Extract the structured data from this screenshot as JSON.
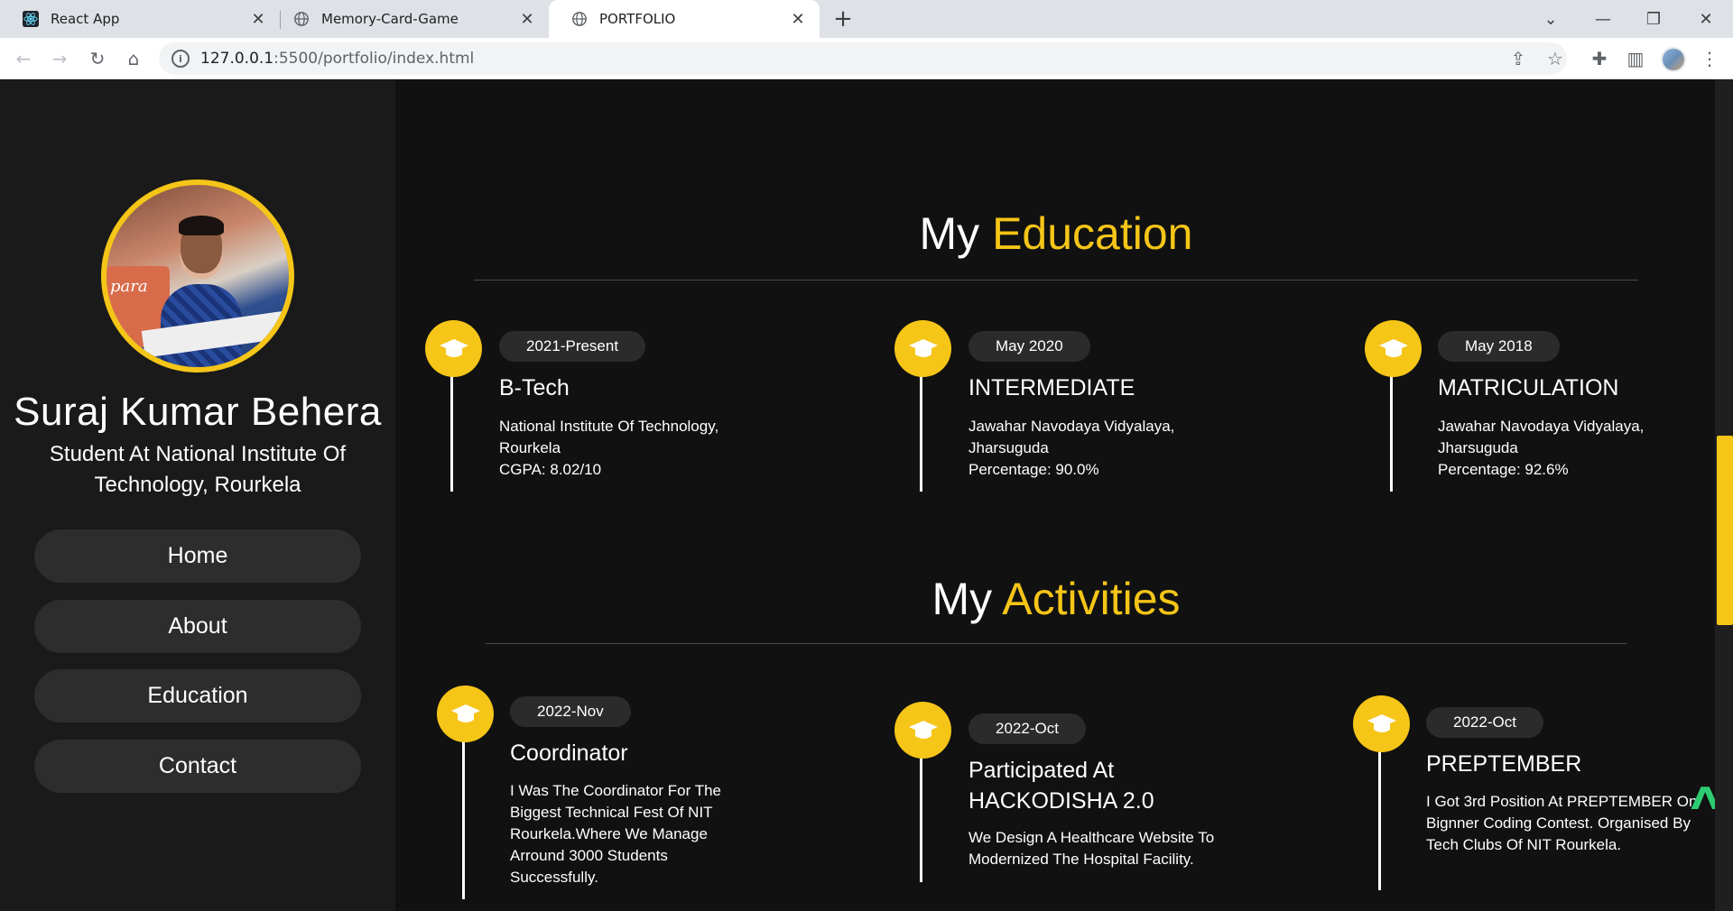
{
  "browser": {
    "tabs": [
      {
        "title": "React App",
        "icon": "react-icon"
      },
      {
        "title": "Memory-Card-Game",
        "icon": "globe-icon"
      },
      {
        "title": "PORTFOLIO",
        "icon": "globe-icon",
        "active": true
      }
    ],
    "url_host": "127.0.0.1",
    "url_rest": ":5500/portfolio/index.html"
  },
  "profile": {
    "name": "Suraj Kumar Behera",
    "subtitle": "Student At National Institute Of Technology, Rourkela"
  },
  "nav": {
    "items": [
      "Home",
      "About",
      "Education",
      "Contact"
    ]
  },
  "education": {
    "title_prefix": "My",
    "title_accent": "Education",
    "items": [
      {
        "date": "2021-Present",
        "title": "B-Tech",
        "line1": "National Institute Of Technology,",
        "line2": "Rourkela",
        "line3": "CGPA: 8.02/10"
      },
      {
        "date": "May 2020",
        "title": "INTERMEDIATE",
        "line1": "Jawahar Navodaya Vidyalaya,",
        "line2": "Jharsuguda",
        "line3": "Percentage: 90.0%"
      },
      {
        "date": "May 2018",
        "title": "MATRICULATION",
        "line1": "Jawahar Navodaya Vidyalaya,",
        "line2": "Jharsuguda",
        "line3": "Percentage: 92.6%"
      }
    ]
  },
  "activities": {
    "title_prefix": "My",
    "title_accent": "Activities",
    "items": [
      {
        "date": "2022-Nov",
        "title": "Coordinator",
        "text": "I Was The Coordinator For The Biggest Technical Fest Of NIT Rourkela.Where We Manage Arround 3000 Students Successfully."
      },
      {
        "date": "2022-Oct",
        "title": "Participated At HACKODISHA 2.0",
        "text": "We Design A Healthcare Website To Modernized The Hospital Facility."
      },
      {
        "date": "2022-Oct",
        "title": "PREPTEMBER",
        "text": "I Got 3rd Position At PREPTEMBER On Bignner Coding Contest. Organised By Tech Clubs Of NIT Rourkela."
      }
    ]
  },
  "colors": {
    "accent": "#f5c518",
    "background": "#111111",
    "sidebar": "#1a1a1a",
    "pill": "#2b2b2b"
  }
}
